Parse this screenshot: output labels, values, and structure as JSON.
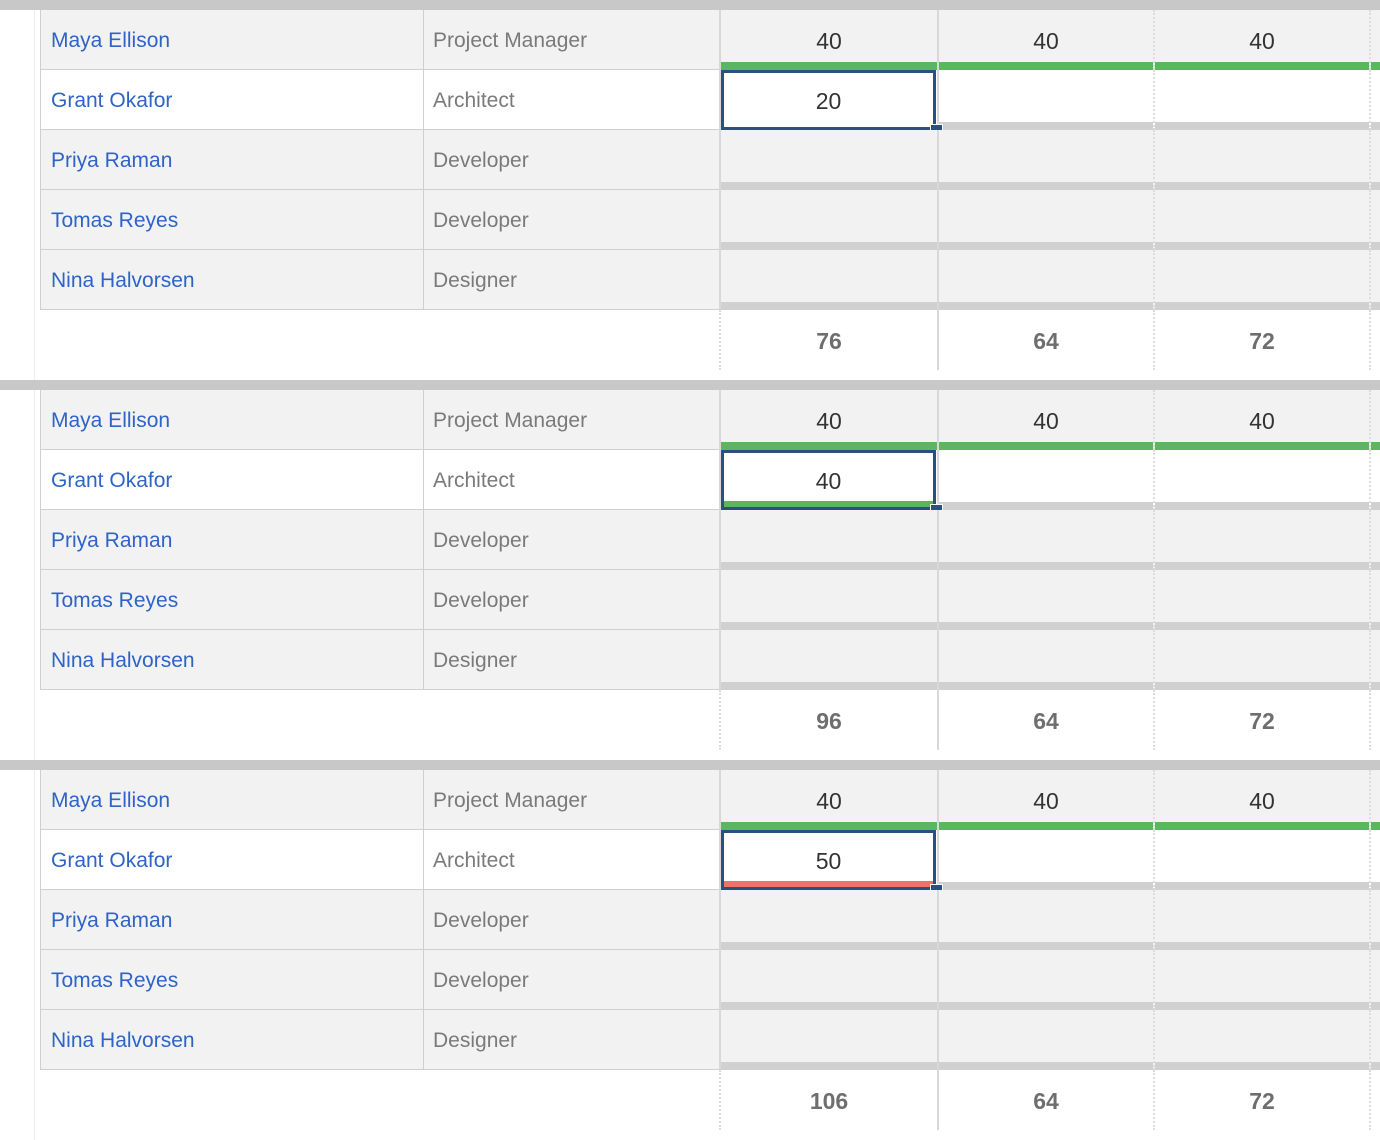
{
  "colors": {
    "bar_ok": "#5cb55f",
    "bar_empty": "#d0d0d0",
    "bar_over": "#f07167",
    "editor_border": "#2b4f7e",
    "name_link": "#2e63c8"
  },
  "panels": [
    {
      "rows": [
        {
          "name": "Maya Ellison",
          "role": "Project Manager",
          "weeks": [
            "40",
            "40",
            "40",
            ""
          ],
          "week_status": [
            "full",
            "full",
            "full",
            "full"
          ]
        },
        {
          "name": "Grant Okafor",
          "role": "Architect",
          "weeks": [
            "20",
            "",
            "",
            ""
          ],
          "week_status": [
            "edit",
            "empty",
            "empty",
            "empty"
          ]
        },
        {
          "name": "Priya Raman",
          "role": "Developer",
          "weeks": [
            "",
            "",
            "",
            ""
          ],
          "week_status": [
            "empty",
            "empty",
            "empty",
            "empty"
          ]
        },
        {
          "name": "Tomas Reyes",
          "role": "Developer",
          "weeks": [
            "",
            "",
            "",
            ""
          ],
          "week_status": [
            "empty",
            "empty",
            "empty",
            "empty"
          ]
        },
        {
          "name": "Nina Halvorsen",
          "role": "Designer",
          "weeks": [
            "",
            "",
            "",
            ""
          ],
          "week_status": [
            "empty",
            "empty",
            "empty",
            "empty"
          ]
        }
      ],
      "editing": {
        "value": "20",
        "fill_fraction": 0,
        "state": "under"
      },
      "totals": [
        "76",
        "64",
        "72",
        ""
      ]
    },
    {
      "rows": [
        {
          "name": "Maya Ellison",
          "role": "Project Manager",
          "weeks": [
            "40",
            "40",
            "40",
            ""
          ],
          "week_status": [
            "full",
            "full",
            "full",
            "full"
          ]
        },
        {
          "name": "Grant Okafor",
          "role": "Architect",
          "weeks": [
            "40",
            "",
            "",
            ""
          ],
          "week_status": [
            "edit",
            "empty",
            "empty",
            "empty"
          ]
        },
        {
          "name": "Priya Raman",
          "role": "Developer",
          "weeks": [
            "",
            "",
            "",
            ""
          ],
          "week_status": [
            "empty",
            "empty",
            "empty",
            "empty"
          ]
        },
        {
          "name": "Tomas Reyes",
          "role": "Developer",
          "weeks": [
            "",
            "",
            "",
            ""
          ],
          "week_status": [
            "empty",
            "empty",
            "empty",
            "empty"
          ]
        },
        {
          "name": "Nina Halvorsen",
          "role": "Designer",
          "weeks": [
            "",
            "",
            "",
            ""
          ],
          "week_status": [
            "empty",
            "empty",
            "empty",
            "empty"
          ]
        }
      ],
      "editing": {
        "value": "40",
        "fill_fraction": 1,
        "state": "full"
      },
      "totals": [
        "96",
        "64",
        "72",
        ""
      ]
    },
    {
      "rows": [
        {
          "name": "Maya Ellison",
          "role": "Project Manager",
          "weeks": [
            "40",
            "40",
            "40",
            ""
          ],
          "week_status": [
            "full",
            "full",
            "full",
            "full"
          ]
        },
        {
          "name": "Grant Okafor",
          "role": "Architect",
          "weeks": [
            "50",
            "",
            "",
            ""
          ],
          "week_status": [
            "edit",
            "empty",
            "empty",
            "empty"
          ]
        },
        {
          "name": "Priya Raman",
          "role": "Developer",
          "weeks": [
            "",
            "",
            "",
            ""
          ],
          "week_status": [
            "empty",
            "empty",
            "empty",
            "empty"
          ]
        },
        {
          "name": "Tomas Reyes",
          "role": "Developer",
          "weeks": [
            "",
            "",
            "",
            ""
          ],
          "week_status": [
            "empty",
            "empty",
            "empty",
            "empty"
          ]
        },
        {
          "name": "Nina Halvorsen",
          "role": "Designer",
          "weeks": [
            "",
            "",
            "",
            ""
          ],
          "week_status": [
            "empty",
            "empty",
            "empty",
            "empty"
          ]
        }
      ],
      "editing": {
        "value": "50",
        "fill_fraction": 1,
        "state": "over"
      },
      "totals": [
        "106",
        "64",
        "72",
        ""
      ]
    }
  ]
}
